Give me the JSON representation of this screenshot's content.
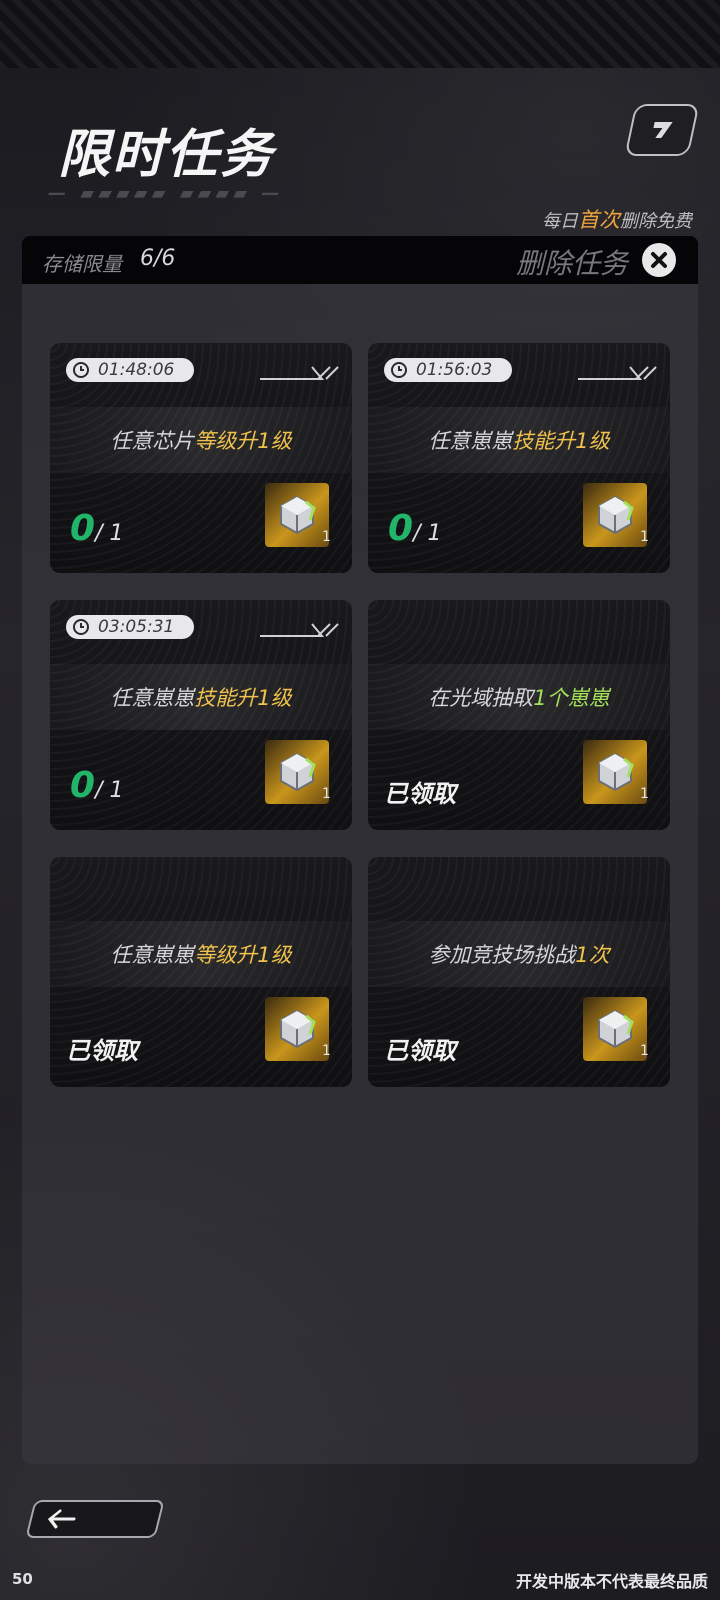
{
  "header": {
    "title": "限时任务",
    "free_note_prefix": "每日",
    "free_note_highlight": "首次",
    "free_note_suffix": "删除免费"
  },
  "storage": {
    "label": "存储限量",
    "value": "6/6",
    "delete_label": "删除任务"
  },
  "tasks": [
    {
      "timer": "01:48:06",
      "text_pre": "任意芯片",
      "text_hl": "等级升1级",
      "progress_current": "0",
      "progress_total": "/ 1",
      "reward_count": "1",
      "status": ""
    },
    {
      "timer": "01:56:03",
      "text_pre": "任意崽崽",
      "text_hl": "技能升1级",
      "progress_current": "0",
      "progress_total": "/ 1",
      "reward_count": "1",
      "status": ""
    },
    {
      "timer": "03:05:31",
      "text_pre": "任意崽崽",
      "text_hl": "技能升1级",
      "progress_current": "0",
      "progress_total": "/ 1",
      "reward_count": "1",
      "status": ""
    },
    {
      "timer": "",
      "text_pre": "在光域抽取",
      "text_hl": "1个崽崽",
      "progress_current": "",
      "progress_total": "",
      "reward_count": "1",
      "status": "已领取"
    },
    {
      "timer": "",
      "text_pre": "任意崽崽",
      "text_hl": "等级升1级",
      "progress_current": "",
      "progress_total": "",
      "reward_count": "1",
      "status": "已领取"
    },
    {
      "timer": "",
      "text_pre": "参加竞技场挑战",
      "text_hl": "1次",
      "progress_current": "",
      "progress_total": "",
      "reward_count": "1",
      "status": "已领取"
    }
  ],
  "footer": {
    "fps": "50",
    "disclaimer": "开发中版本不代表最终品质"
  },
  "colors": {
    "progress_green": "#22b56a",
    "highlight_gold": "#f0c24c",
    "highlight_green": "#a4e05a",
    "accent_orange": "#f0a53c"
  },
  "icons": {
    "top_button": "share-arrow-icon",
    "close": "close-icon",
    "timer": "clock-icon",
    "reward": "chip-cube-icon",
    "back": "arrow-left-icon"
  }
}
